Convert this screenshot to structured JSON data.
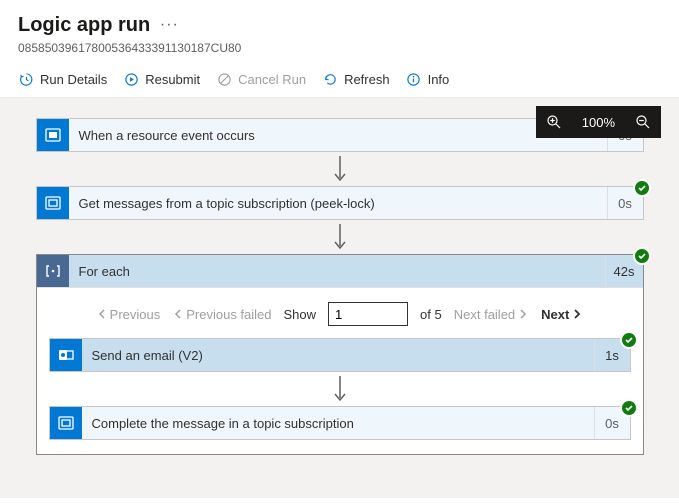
{
  "header": {
    "title": "Logic app run",
    "run_id": "08585039617800536433391130187CU80"
  },
  "toolbar": {
    "run_details": "Run Details",
    "resubmit": "Resubmit",
    "cancel_run": "Cancel Run",
    "refresh": "Refresh",
    "info": "Info"
  },
  "zoom": {
    "percent": "100%"
  },
  "steps": {
    "trigger": {
      "title": "When a resource event occurs",
      "time": "0s"
    },
    "get_messages": {
      "title": "Get messages from a topic subscription (peek-lock)",
      "time": "0s"
    },
    "foreach": {
      "title": "For each",
      "time": "42s",
      "pager": {
        "previous": "Previous",
        "previous_failed": "Previous failed",
        "show_label": "Show",
        "current": "1",
        "of_total": "of 5",
        "next_failed": "Next failed",
        "next": "Next"
      },
      "children": {
        "send_email": {
          "title": "Send an email (V2)",
          "time": "1s"
        },
        "complete_msg": {
          "title": "Complete the message in a topic subscription",
          "time": "0s"
        }
      }
    }
  }
}
